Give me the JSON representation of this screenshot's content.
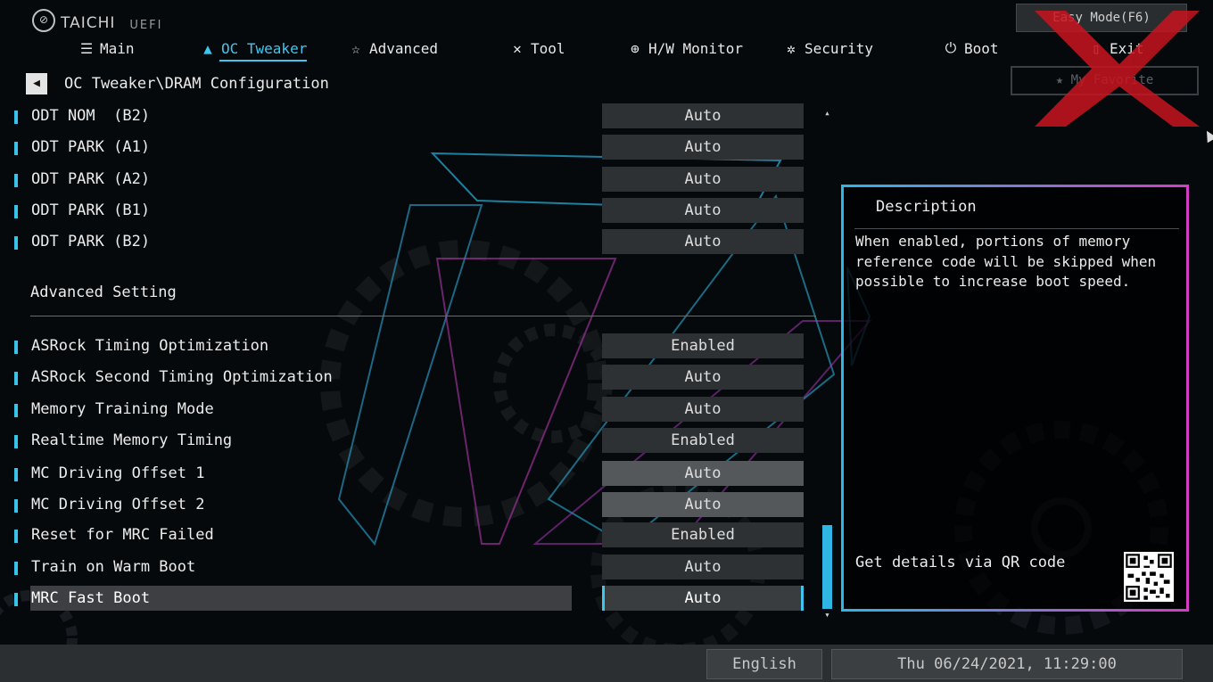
{
  "logo": {
    "brand": "TAICHI",
    "suffix": "UEFI"
  },
  "header": {
    "tabs": [
      {
        "label": "Main",
        "icon": "list-icon"
      },
      {
        "label": "OC Tweaker",
        "icon": "rocket-icon",
        "active": true
      },
      {
        "label": "Advanced",
        "icon": "star-icon"
      },
      {
        "label": "Tool",
        "icon": "tools-icon"
      },
      {
        "label": "H/W Monitor",
        "icon": "monitor-icon"
      },
      {
        "label": "Security",
        "icon": "shield-icon"
      },
      {
        "label": "Boot",
        "icon": "power-icon"
      },
      {
        "label": "Exit",
        "icon": "door-icon"
      }
    ],
    "easy_mode": "Easy Mode(F6)",
    "my_favorite": "My Favorite"
  },
  "breadcrumb": "OC Tweaker\\DRAM Configuration",
  "top_items": [
    {
      "label": "ODT NOM  (B2)",
      "value": "Auto"
    },
    {
      "label": "ODT PARK (A1)",
      "value": "Auto"
    },
    {
      "label": "ODT PARK (A2)",
      "value": "Auto"
    },
    {
      "label": "ODT PARK (B1)",
      "value": "Auto"
    },
    {
      "label": "ODT PARK (B2)",
      "value": "Auto"
    }
  ],
  "section_title": "Advanced Setting",
  "adv_items": [
    {
      "label": "ASRock Timing Optimization",
      "value": "Enabled"
    },
    {
      "label": "ASRock Second Timing Optimization",
      "value": "Auto"
    },
    {
      "label": "Memory Training Mode",
      "value": "Auto"
    },
    {
      "label": "Realtime Memory Timing",
      "value": "Enabled"
    },
    {
      "label": "MC Driving Offset 1",
      "value": "Auto",
      "disabled": true
    },
    {
      "label": "MC Driving Offset 2",
      "value": "Auto",
      "disabled": true
    },
    {
      "label": "Reset for MRC Failed",
      "value": "Enabled"
    },
    {
      "label": "Train on Warm Boot",
      "value": "Auto"
    },
    {
      "label": "MRC Fast Boot",
      "value": "Auto",
      "selected": true
    }
  ],
  "description": {
    "title": "Description",
    "text": "When enabled, portions of memory reference code will be skipped when possible to increase boot speed.",
    "qr_label": "Get details via QR code"
  },
  "footer": {
    "language": "English",
    "datetime": "Thu 06/24/2021, 11:29:00"
  },
  "colors": {
    "accent": "#3fc6ef",
    "magenta": "#d13ec2",
    "watermark": "#c8141e"
  }
}
